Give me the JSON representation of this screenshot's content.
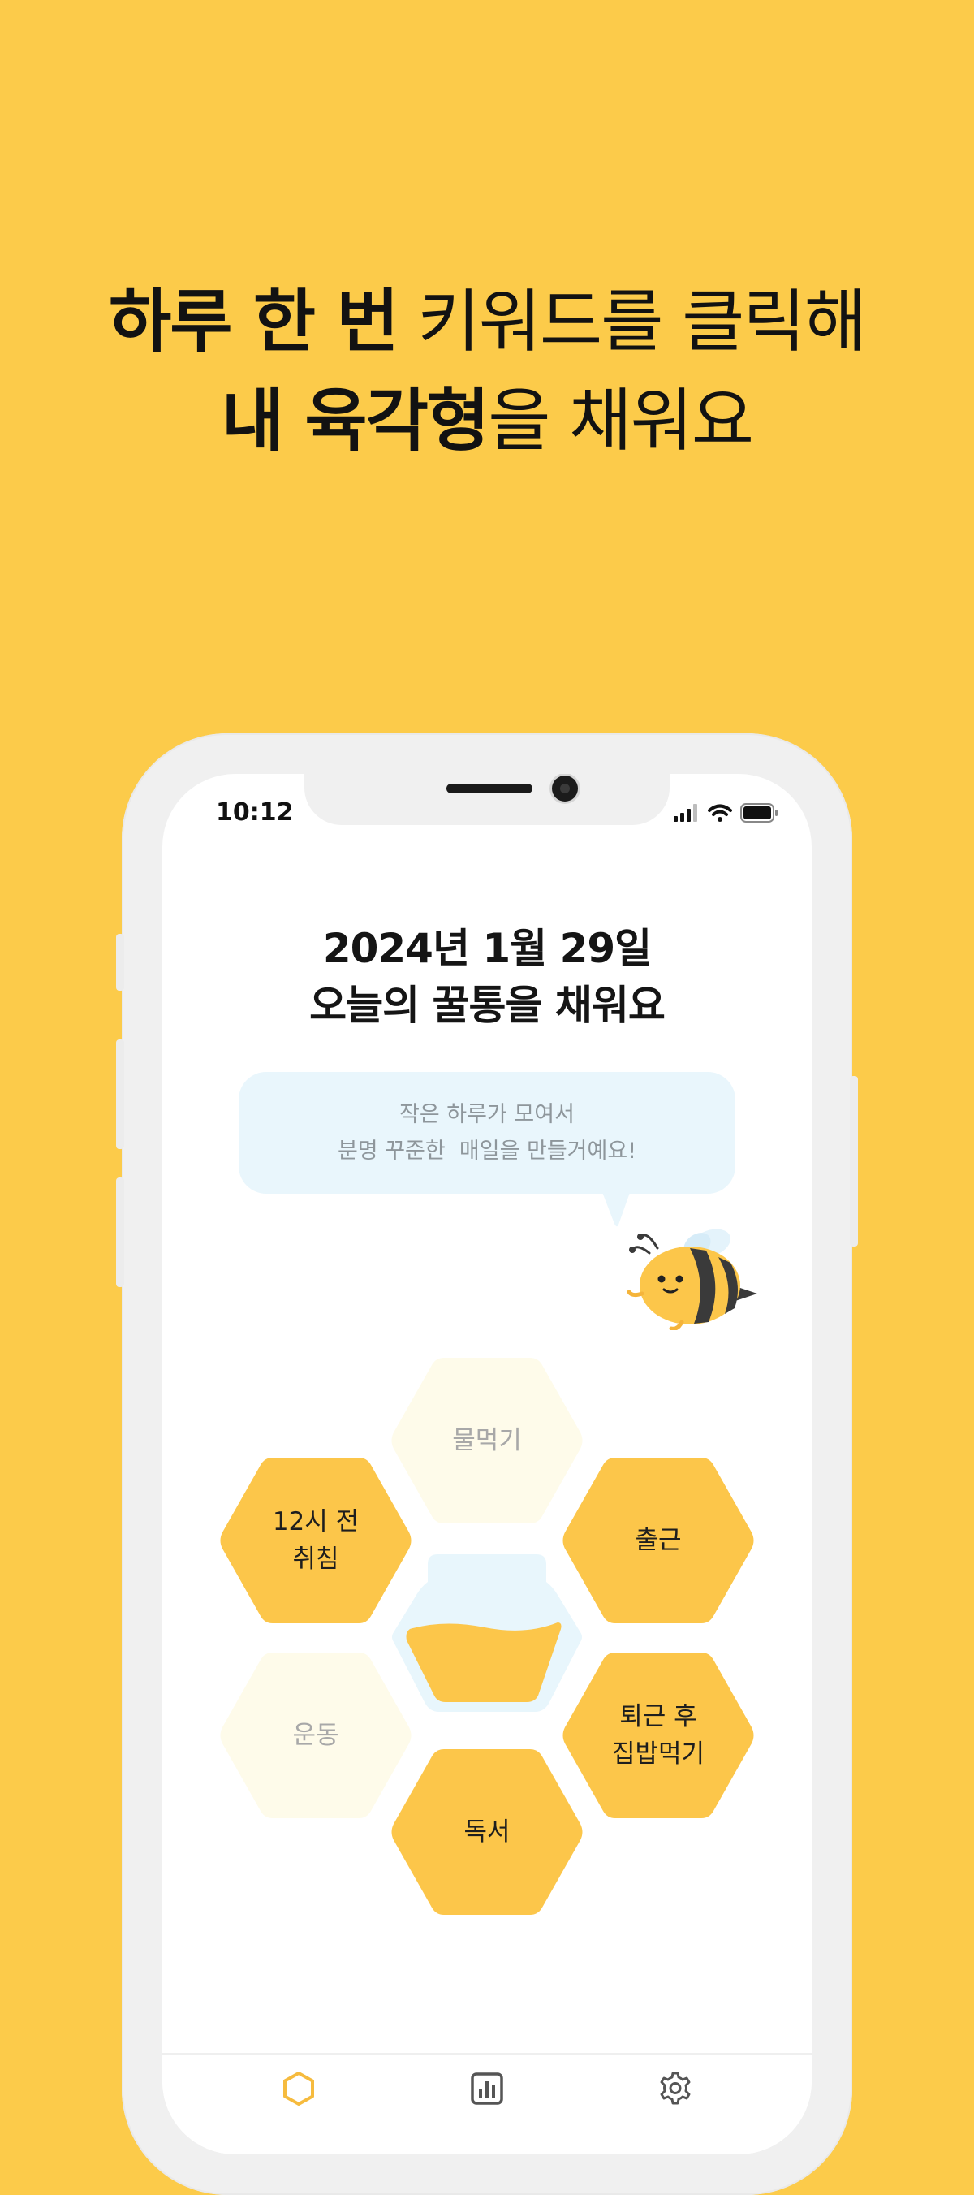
{
  "headline": {
    "line1_bold": "하루 한 번",
    "line1_light": " 키워드를 클릭해",
    "line2_bold": "내 육각형",
    "line2_light": "을 채워요"
  },
  "status_bar": {
    "time": "10:12"
  },
  "date_line": "2024년 1월 29일",
  "subtitle": "오늘의 꿀통을 채워요",
  "bubble": {
    "line1": "작은 하루가 모여서",
    "line2": "분명 꾸준한  매일을 만들거예요!"
  },
  "hexagons": [
    {
      "label": "물먹기",
      "state": "empty"
    },
    {
      "label": "12시 전\n취침",
      "state": "filled"
    },
    {
      "label": "출근",
      "state": "filled"
    },
    {
      "label": "운동",
      "state": "empty"
    },
    {
      "label": "퇴근 후\n집밥먹기",
      "state": "filled"
    },
    {
      "label": "독서",
      "state": "filled"
    }
  ],
  "colors": {
    "background": "#FCCB4A",
    "hex_filled": "#FCC64A",
    "hex_empty": "#FEFBEA",
    "honey_jar": "#E8F6FC",
    "accent": "#F6BB3E"
  },
  "tabs": [
    {
      "icon": "hexagon-icon",
      "active": true
    },
    {
      "icon": "chart-icon",
      "active": false
    },
    {
      "icon": "gear-icon",
      "active": false
    }
  ]
}
